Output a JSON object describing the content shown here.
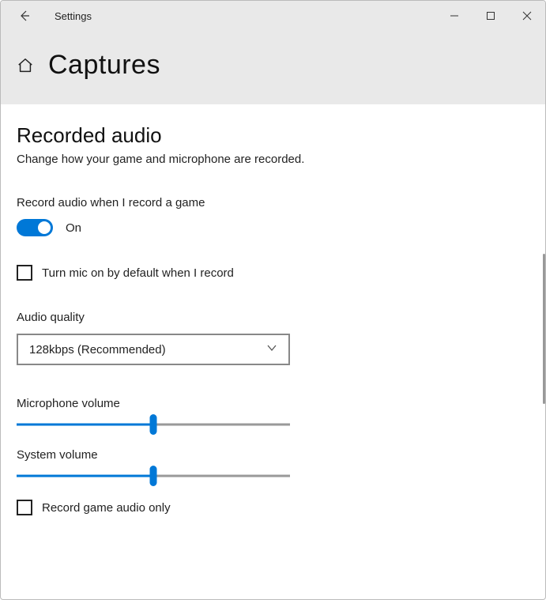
{
  "titlebar": {
    "title": "Settings"
  },
  "header": {
    "page_title": "Captures"
  },
  "section": {
    "title": "Recorded audio",
    "desc": "Change how your game and microphone are recorded."
  },
  "record_toggle": {
    "label": "Record audio when I record a game",
    "state": "On",
    "on": true
  },
  "mic_default": {
    "label": "Turn mic on by default when I record",
    "checked": false
  },
  "audio_quality": {
    "label": "Audio quality",
    "value": "128kbps (Recommended)"
  },
  "mic_volume": {
    "label": "Microphone volume",
    "value": 50
  },
  "sys_volume": {
    "label": "System volume",
    "value": 50
  },
  "record_game_only": {
    "label": "Record game audio only",
    "checked": false
  }
}
